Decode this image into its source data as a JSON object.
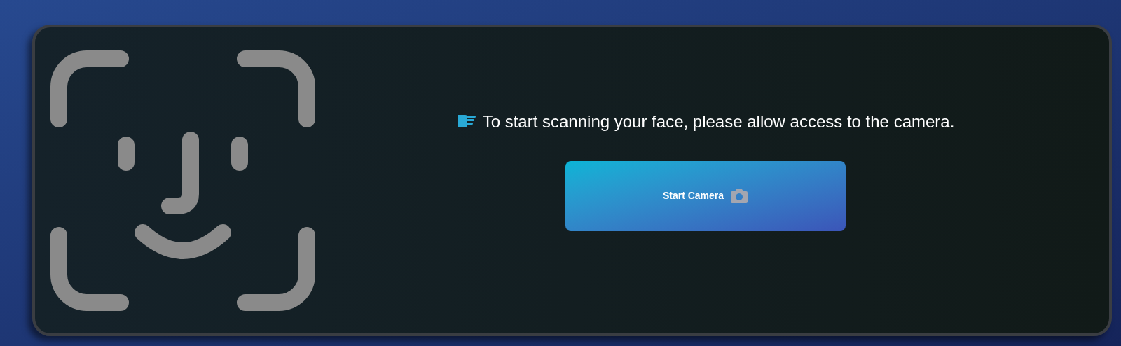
{
  "message": "To start scanning your face, please allow access to the camera.",
  "button": {
    "label": "Start Camera"
  }
}
